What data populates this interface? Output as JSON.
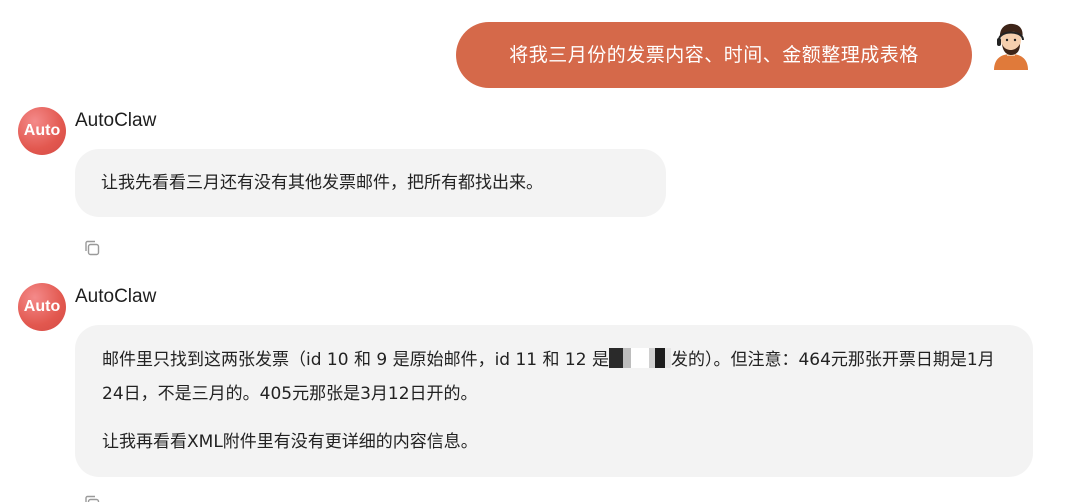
{
  "user_message": {
    "text": "将我三月份的发票内容、时间、金额整理成表格",
    "bubble_color": "#d5694a"
  },
  "messages": [
    {
      "avatar_text": "Auto",
      "name": "AutoClaw",
      "text": "让我先看看三月还有没有其他发票邮件，把所有都找出来。"
    },
    {
      "avatar_text": "Auto",
      "name": "AutoClaw",
      "para1_part1": "邮件里只找到这两张发票（id 10 和 9 是原始邮件，id 11 和 12 是",
      "para1_part2": "发的）。但注意：464元那张开票日期是1月24日，不是三月的。405元那张是3月12日开的。",
      "para2": "让我再看看XML附件里有没有更详细的内容信息。"
    }
  ],
  "colors": {
    "accent": "#d5694a",
    "bot_avatar": "#e2584f",
    "bubble_bg": "#f3f3f3"
  },
  "icons": {
    "copy": "copy-icon",
    "user_avatar": "user-avatar"
  }
}
